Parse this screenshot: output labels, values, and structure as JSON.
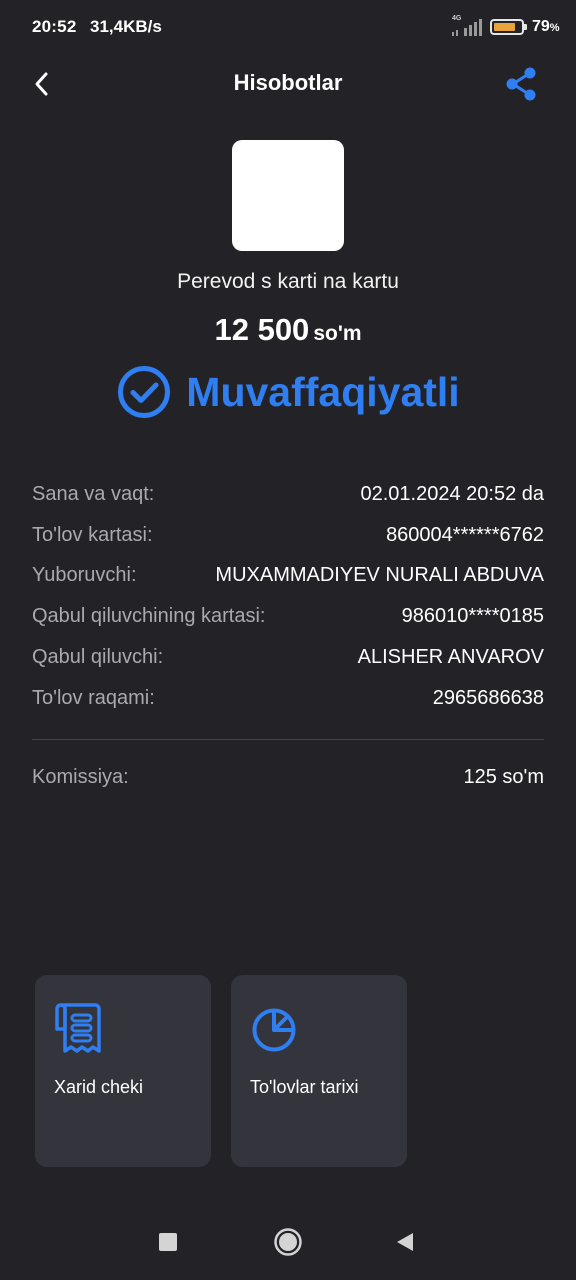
{
  "status_bar": {
    "time": "20:52",
    "speed": "31,4KB/s",
    "network": "4G",
    "battery_percent": "79",
    "battery_unit": "%",
    "battery_level": 0.79
  },
  "header": {
    "title": "Hisobotlar",
    "back_icon": "chevron-left-icon",
    "share_icon": "share-icon"
  },
  "transaction": {
    "type": "Perevod s karti na kartu",
    "amount": "12 500",
    "currency": "so'm",
    "status": "Muvaffaqiyatli",
    "status_color": "#2f7ff2"
  },
  "details": [
    {
      "label": "Sana va vaqt:",
      "value": "02.01.2024 20:52 da"
    },
    {
      "label": "To'lov kartasi:",
      "value": "860004******6762"
    },
    {
      "label": "Yuboruvchi:",
      "value": "MUXAMMADIYEV NURALI ABDUVA"
    },
    {
      "label": "Qabul qiluvchining kartasi:",
      "value": "986010****0185"
    },
    {
      "label": "Qabul qiluvchi:",
      "value": "ALISHER ANVAROV"
    },
    {
      "label": "To'lov raqami:",
      "value": "2965686638"
    }
  ],
  "fee": {
    "label": "Komissiya:",
    "value": "125 so'm"
  },
  "actions": [
    {
      "label": "Xarid cheki",
      "icon": "receipt-icon"
    },
    {
      "label": "To'lovlar tarixi",
      "icon": "pie-chart-icon"
    }
  ],
  "colors": {
    "background": "#232327",
    "accent": "#2f7ff2",
    "card": "#34353c"
  }
}
